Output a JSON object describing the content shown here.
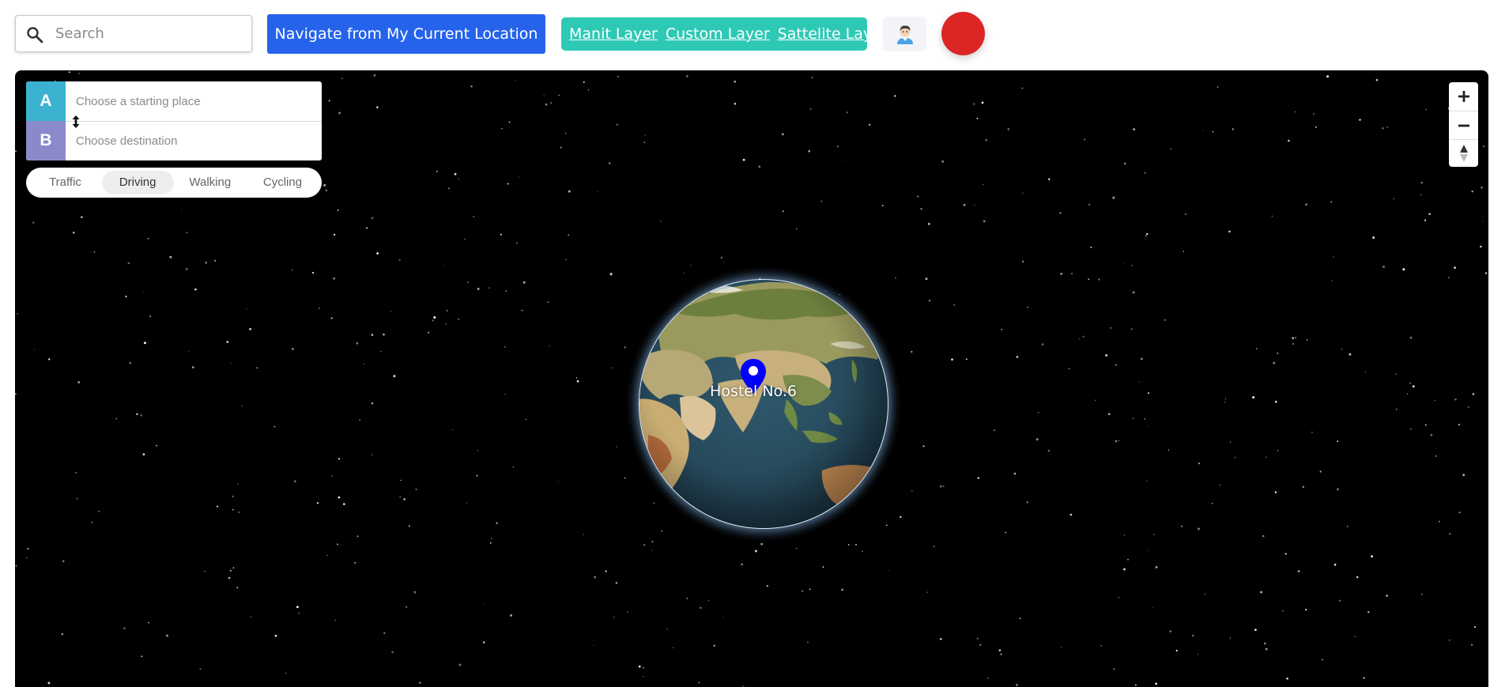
{
  "search": {
    "placeholder": "Search",
    "icon": "search-icon"
  },
  "navigate_button": {
    "label": "Navigate from My Current Location",
    "color": "#2563eb"
  },
  "layers": {
    "color": "#2ec9b5",
    "items": [
      {
        "label": "Manit Layer"
      },
      {
        "label": "Custom Layer"
      },
      {
        "label": "Sattelite Layer"
      }
    ]
  },
  "profile_button": {
    "icon": "user-avatar-icon"
  },
  "record_button": {
    "icon": "record-icon",
    "color": "#dc2626"
  },
  "directions": {
    "origin": {
      "badge": "A",
      "placeholder": "Choose a starting place",
      "color": "#3bb2d0"
    },
    "destination": {
      "badge": "B",
      "placeholder": "Choose destination",
      "color": "#8a8acb"
    },
    "profiles": [
      {
        "label": "Traffic",
        "active": false
      },
      {
        "label": "Driving",
        "active": true
      },
      {
        "label": "Walking",
        "active": false
      },
      {
        "label": "Cycling",
        "active": false
      }
    ]
  },
  "map_controls": {
    "zoom_in": "plus-icon",
    "zoom_out": "minus-icon",
    "compass": "compass-icon"
  },
  "marker": {
    "label": "Hostel No.6",
    "color": "#0000ff"
  }
}
